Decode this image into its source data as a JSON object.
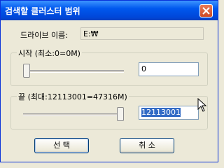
{
  "window": {
    "title": "검색할 클러스터 범위"
  },
  "drive": {
    "label": "드라이브 이름:",
    "value": "E:₩"
  },
  "start_group": {
    "legend": "시작 (최소:0=0M)",
    "value": "0",
    "slider_fraction": 0.0
  },
  "end_group": {
    "legend": "끝 (최대:12113001=47316M)",
    "value": "12113001",
    "slider_fraction": 1.0
  },
  "buttons": {
    "ok_label": "선 택",
    "cancel_label": "취 소"
  },
  "icons": {
    "close": "close-icon",
    "cursor": "mouse-cursor-icon"
  },
  "colors": {
    "titlebar": "#0058ee",
    "selection": "#316ac5",
    "close_button": "#cc4a24"
  }
}
